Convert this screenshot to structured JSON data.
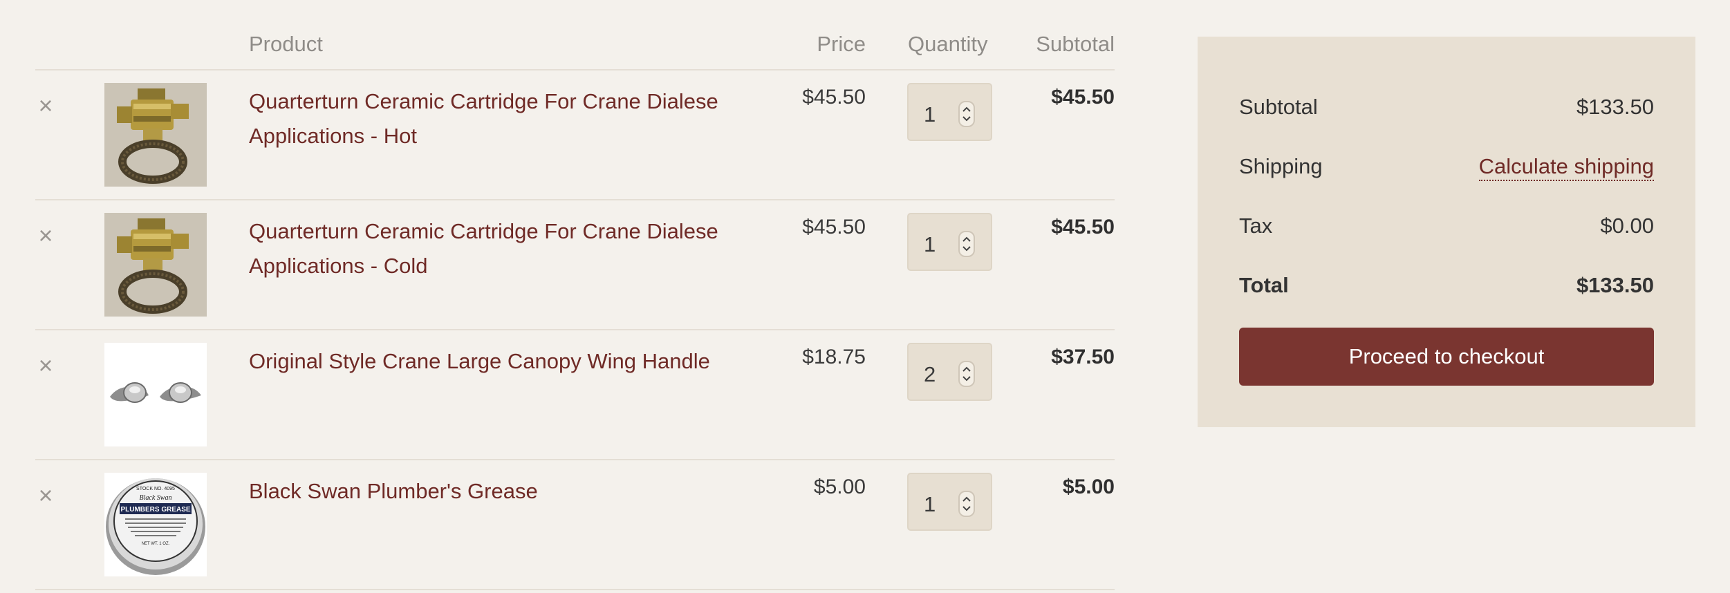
{
  "table": {
    "headers": {
      "product": "Product",
      "price": "Price",
      "quantity": "Quantity",
      "subtotal": "Subtotal"
    }
  },
  "items": [
    {
      "remove": "×",
      "name_line1": "Quarterturn Ceramic Cartridge For Crane Dialese",
      "name_line2": "Applications - Hot",
      "price": "$45.50",
      "quantity": "1",
      "subtotal": "$45.50",
      "image": "brass-cartridge"
    },
    {
      "remove": "×",
      "name_line1": "Quarterturn Ceramic Cartridge For Crane Dialese",
      "name_line2": "Applications - Cold",
      "price": "$45.50",
      "quantity": "1",
      "subtotal": "$45.50",
      "image": "brass-cartridge"
    },
    {
      "remove": "×",
      "name_line1": "Original Style Crane Large Canopy Wing Handle",
      "name_line2": "",
      "price": "$18.75",
      "quantity": "2",
      "subtotal": "$37.50",
      "image": "chrome-wing-handles"
    },
    {
      "remove": "×",
      "name_line1": "Black Swan Plumber's Grease",
      "name_line2": "",
      "price": "$5.00",
      "quantity": "1",
      "subtotal": "$5.00",
      "image": "grease-tin"
    }
  ],
  "totals": {
    "subtotal_label": "Subtotal",
    "subtotal_value": "$133.50",
    "shipping_label": "Shipping",
    "shipping_link": "Calculate shipping",
    "tax_label": "Tax",
    "tax_value": "$0.00",
    "total_label": "Total",
    "total_value": "$133.50",
    "checkout_label": "Proceed to checkout"
  },
  "colors": {
    "background": "#f4f1ec",
    "link": "#6f2a26",
    "panel": "#e8e0d3",
    "button": "#7a3530"
  },
  "grease_tin": {
    "top_text": "STOCK NO. 4095",
    "brand": "Black Swan",
    "label": "PLUMBERS GREASE",
    "bottom": "NET WT. 1 OZ."
  }
}
